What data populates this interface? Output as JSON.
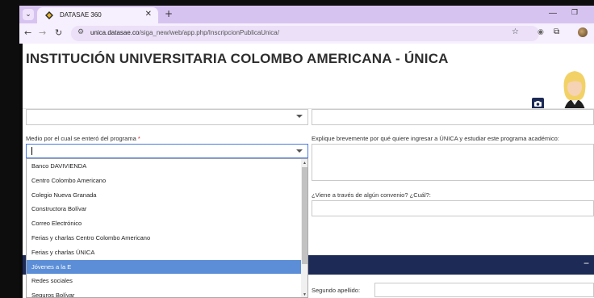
{
  "browser": {
    "tab_title": "DATASAE 360",
    "url_domain": "unica.datasae.co",
    "url_path": "/siga_new/web/app.php/InscripcionPublicaUnica/"
  },
  "page": {
    "heading": "INSTITUCIÓN UNIVERSITARIA COLOMBO AMERICANA - ÚNICA"
  },
  "form": {
    "medio_label": "Medio por el cual se enteró del programa",
    "required_mark": "*",
    "explique_label": "Explique brevemente por qué quiere ingresar a ÚNICA y estudiar este programa académico:",
    "convenio_label": "¿Viene a través de algún convenio? ¿Cuál?:",
    "segundo_apellido_label": "Segundo apellido:",
    "collapse_symbol": "−"
  },
  "dropdown": {
    "options": [
      "Banco DAVIVIENDA",
      "Centro Colombo Americano",
      "Colegio Nueva Granada",
      "Constructora Bolívar",
      "Correo Electrónico",
      "Ferias y charlas Centro Colombo Americano",
      "Ferias y charlas ÚNICA",
      "Jóvenes a la E",
      "Redes sociales",
      "Seguros Bolívar"
    ],
    "selected_index": 7
  },
  "colors": {
    "tabbar": "#d7c3f0",
    "header_bar": "#1c2a55",
    "highlight": "#5b8ed6",
    "required": "#e0252b"
  }
}
